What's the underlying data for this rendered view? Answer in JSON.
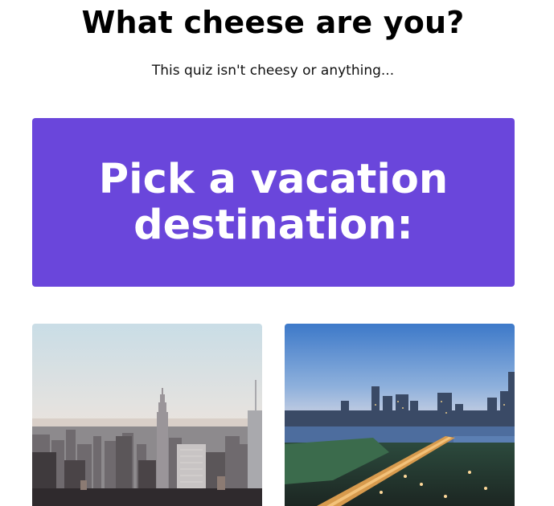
{
  "header": {
    "title": "What cheese are you?",
    "subtitle": "This quiz isn't cheesy or anything..."
  },
  "question": {
    "text": "Pick a vacation destination:"
  },
  "options": [
    {
      "image": "new-york-city-skyline-photo"
    },
    {
      "image": "austin-city-skyline-photo"
    }
  ],
  "colors": {
    "question_bg": "#6a46db",
    "question_text": "#ffffff",
    "title_text": "#000000"
  }
}
